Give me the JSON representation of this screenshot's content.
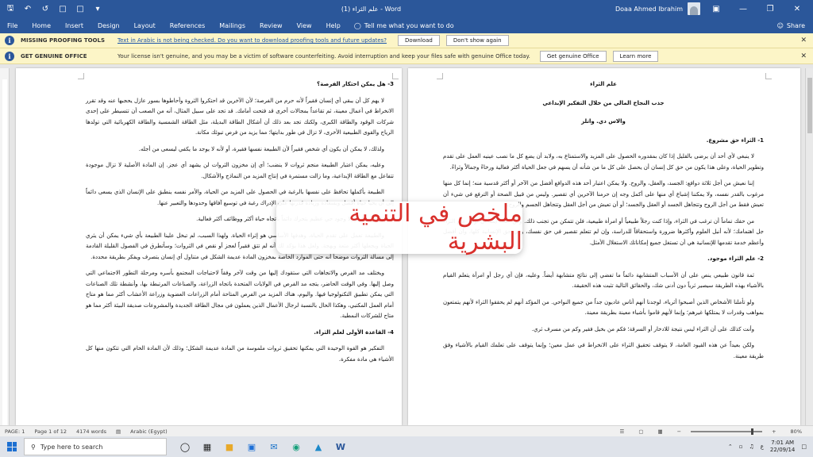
{
  "window": {
    "title": "علم الثراء (1) - Word",
    "user": "Doaa Ahmed Ibrahim",
    "share": "Share",
    "tell_me": "Tell me what you want to do"
  },
  "ribbon": {
    "tabs": [
      "File",
      "Home",
      "Insert",
      "Design",
      "Layout",
      "References",
      "Mailings",
      "Review",
      "View",
      "Help"
    ]
  },
  "messages": [
    {
      "head": "MISSING PROOFING TOOLS",
      "text": "Text in Arabic is not being checked. Do you want to download proofing tools and future updates?",
      "buttons": [
        "Download",
        "Don't show again"
      ]
    },
    {
      "head": "GET GENUINE OFFICE",
      "text": "Your license isn't genuine, and you may be a victim of software counterfeiting. Avoid interruption and keep your files safe with genuine Office today.",
      "buttons": [
        "Get genuine Office",
        "Learn more"
      ]
    }
  ],
  "left_page": [
    {
      "type": "h",
      "text": "3- هل يمكن احتكار الفرصة؟"
    },
    {
      "type": "p",
      "text": "لا يهم كل أن يبقى أي إنسان فقيراً لأنه حرم من الفرصة؛ لأن الآخرين قد احتكروا الثروة وأحاطوها بسور عازل يحجبها عنه وقد تقرر الانخراط في أعمال معينة، ثم تقاعداً بمجالات أخرى قد فتحت أمامك. قد تجد على سبيل المثال، أنه من الصعب أن تتسيطر على إحدى شركات الوقود والطاقة الكبرى، ولكنك تجد بعد ذلك أن أشكال الطاقة البديلة، مثل الطاقة الشمسية والطاقة الكهربائية التي تولدها الرياح والقوى الطبيعية الأخرى، لا تزال في طور بدايتها؛ مما يزيد من فرص تبوئك مكانة."
    },
    {
      "type": "p",
      "text": "ولذلك، لا يمكن أن يكون أي شخص فقيراً لأن الطبيعة نفسها فقيرة، أو لأنه لا يوجد ما يكفي ليسعى من أجله."
    },
    {
      "type": "p",
      "text": "وعليه، يمكن اعتبار الطبيعة منجم ثروات لا ينضب؛ أي إن مخزون الثروات لن يشهد أي عجز. إن المادة الأصلية لا تزال موجودة تتفاعل مع الطاقة الإبداعية، وما زالت مستمرة في إنتاج المزيد من النماذج والأشكال."
    },
    {
      "type": "p",
      "text": "الطبيعة بأكملها تحافظ على نفسها بالرغبة في الحصول على المزيد من الحياة، والأمر نفسه ينطبق على الإنسان الذي يسعى دائماً إلى أن يحيا حياة أفضل وبسعادة وزيادة قدرتها على الإدراك رغبة في توسيع آفاقها وحدودها والتعبير عنها."
    },
    {
      "type": "p",
      "text": "والكون ما هو إلا وجود حي عظيم يتحرك دائماً باتجاه حياة أكثر ووظائف أكثر فعالية."
    },
    {
      "type": "p",
      "text": "والطبيعة تعمل على تقدم الحياة، وهدفها الأساسي هو إثراء الحياة. ولهذا السبب، لم تبخل علينا الطبيعة بأي شيء يمكن أن يثري الحياة ويجعلها أكثر متعة وبهجة. ولعل هذا يؤكد لك أنه لم تتق فقيراً لعجز أو نقص في الثروات؛ وسأتطرق في الفصول القليلة القادمة إلى مسألة الثروات موضحاً أنه حتى الموارد الخاصة بمخزون المادة عديمة الشكل في متناول أي إنسان يتصرف ويفكر بطريقة محددة."
    },
    {
      "type": "p",
      "text": "ويختلف مد الفرص والاتجاهات التي ستقودك إليها من وقت لآخر وفقاً لاحتياجات المجتمع بأسره ومرحلة التطور الاجتماعي التي وصل إليها. وفي الوقت الحاضر، يتجه مد الفرص في الولايات المتحدة باتجاه الزراعة، والصناعات المرتبطة بها، وأنشطة تلك الصناعات التي يمكن تطبيق التكنولوجيا فيها. واليوم، هناك المزيد من الفرص المتاحة أمام الزراعات العضوية وزراعة الأعشاب أكثر مما هو متاح أمام العمل المكتبي، وهكذا الحال بالنسبة لرجال الأعمال الذين يعملون في مجال الطاقة الجديدة والمشروعات صديقة البيئة أكثر مما هو متاح للشركات النمطية."
    },
    {
      "type": "h",
      "text": "4- القاعدة الأولى لعلم الثراء."
    },
    {
      "type": "p",
      "text": "التفكير هو القوة الوحيدة التي يمكنها تحقيق ثروات ملموسة من المادة عديمة الشكل؛ وذلك لأن المادة الخام التي تتكون منها كل الأشياء هي مادة مفكرة."
    }
  ],
  "right_page": [
    {
      "type": "c",
      "text": "علم الثراء"
    },
    {
      "type": "c",
      "text": "جذب النجاح المالي من خلال التفكير الإبداعي"
    },
    {
      "type": "c",
      "text": "والاس دي. واتلز"
    },
    {
      "type": "h",
      "text": "1- الثراء حق مشروع."
    },
    {
      "type": "p",
      "text": "لا ينبغي لأي أحد أن يرضى بالقليل إذا كان بمقدوره الحصول على المزيد والاستمتاع به، ولابد أن يضع كل ما نصب عينيه العمل على تقدم وتطوير الحياة، وعلى هذا يكون من حق كل إنسان أن يحصل على كل ما من شأنه أن يسهم في جعل الحياة أكثر فعالية ورخاءً وجمالاً وثراءً."
    },
    {
      "type": "p",
      "text": "إننا نعيش من أجل ثلاثة دوافع: الجسد، والعقل، والروح. ولا يمكن اعتبار أحد هذه الدوافع أفضل من الآخر أو أكثر قدسية منه؛ إنما كل منها مرغوب بالقدر نفسه، ولا يمكننا إشباع أي منها على أكمل وجه إن حرمنا الآخرين أي تقصير. وليس من قبيل الصحة أو الترفع في شيء أن تعيش فقط من أجل الروح وتتجاهل الجسد أو العقل والجسد؛ أو أن تعيش من أجل العقل وتتجاهل الجسم والروح."
    },
    {
      "type": "p",
      "text": "من حقك تماماً أن ترغب في الثراء، وإذا كنت رجلاً طبيعياً أو امرأة طبيعية، فلن تتمكن من تجنب ذلك. ومن حقك أيضاً أن تولي علم الثراء جل اهتمامك؛ لأنه أنبل العلوم وأكثرها ضرورة واستحقاقاً للدراسة، وإن لم تتعلم تقصير في حق نفسك، وفي حق الإنسانية كلها، وأن أفضل وأعظم خدمة تقدمها للإنسانية هي أن تستغل جميع إمكاناتك الاستغلال الأمثل."
    },
    {
      "type": "h",
      "text": "2- علم الثراء موجود."
    },
    {
      "type": "p",
      "text": "ثمة قانون طبيعي ينص على أن الأسباب المتشابهة دائماً ما تفضي إلى نتائج متشابهة أيضاً. وعليه، فإن أي رجل أو امرأة يتعلم القيام بالأشياء بهذه الطريقة سيصير ثرياً دون أدنى شك، والحقائق التالية تثبت هذه الحقيقة."
    },
    {
      "type": "p",
      "text": "ولو تأملنا الأشخاص الذين أصبحوا أثرياء، لوجدنا أنهم أناس عاديون جداً من جميع النواحي. من المؤكد أنهم لم يحققوا الثراء لأنهم يتمتعون بمواهب وقدرات لا يمتلكها غيرهم؛ وإنما لأنهم قاموا بأشياء معينة بطريقة معينة."
    },
    {
      "type": "p",
      "text": "وأنت كذلك على أن الثراء ليس نتيجة للادخار أو السرقة؛ فكم من بخيل فقير وكم من مسرف ثري."
    },
    {
      "type": "p",
      "text": "ولكن بعيداً عن هذه القيود العامة، لا يتوقف تحقيق الثراء على الانخراط في عمل معين؛ وإنما يتوقف على تعلمك القيام بالأشياء وفق طريقة معينة."
    }
  ],
  "overlay": {
    "text": "ملخص في التنمية البشرية"
  },
  "status": {
    "page": "PAGE: 1",
    "page_of": "Page 1 of 12",
    "words": "4174 words",
    "language": "Arabic (Egypt)",
    "zoom": "80%"
  },
  "taskbar": {
    "search_placeholder": "Type here to search",
    "time": "7:01 AM",
    "date": "22/09/14",
    "lang": "ع"
  }
}
